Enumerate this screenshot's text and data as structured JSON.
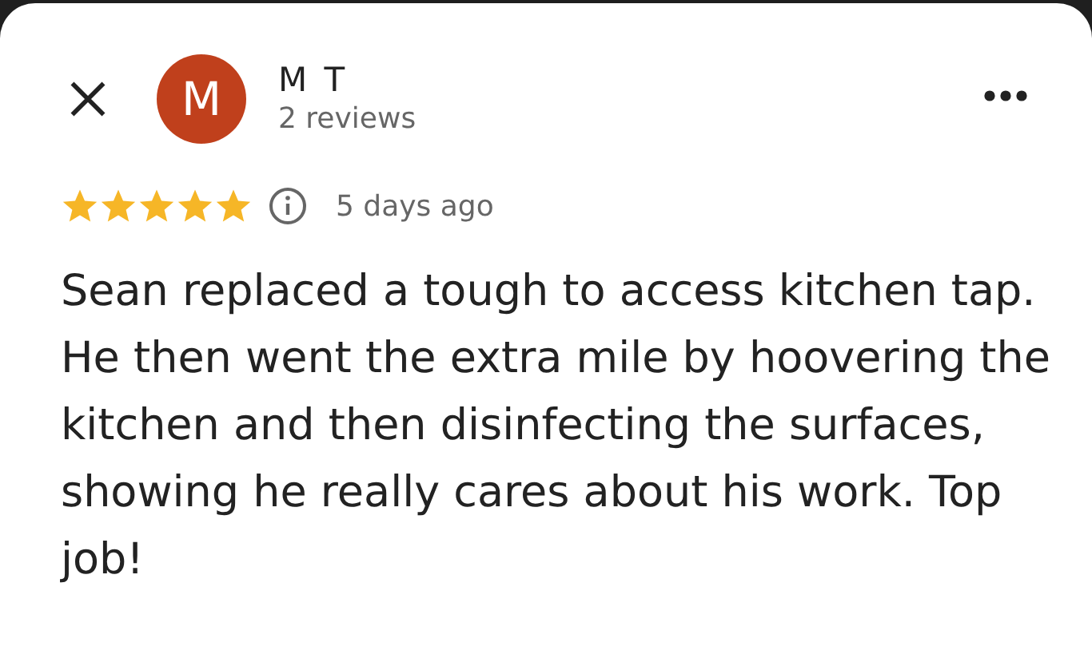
{
  "header": {
    "avatar_letter": "M",
    "name": "M T",
    "subtitle": "2 reviews"
  },
  "rating": {
    "stars": 5,
    "time": "5 days ago"
  },
  "review": {
    "text": "Sean replaced a tough to access kitchen tap. He then went the extra mile by hoovering the kitchen and then disinfecting the surfaces, showing he really cares about his work. Top job!"
  }
}
